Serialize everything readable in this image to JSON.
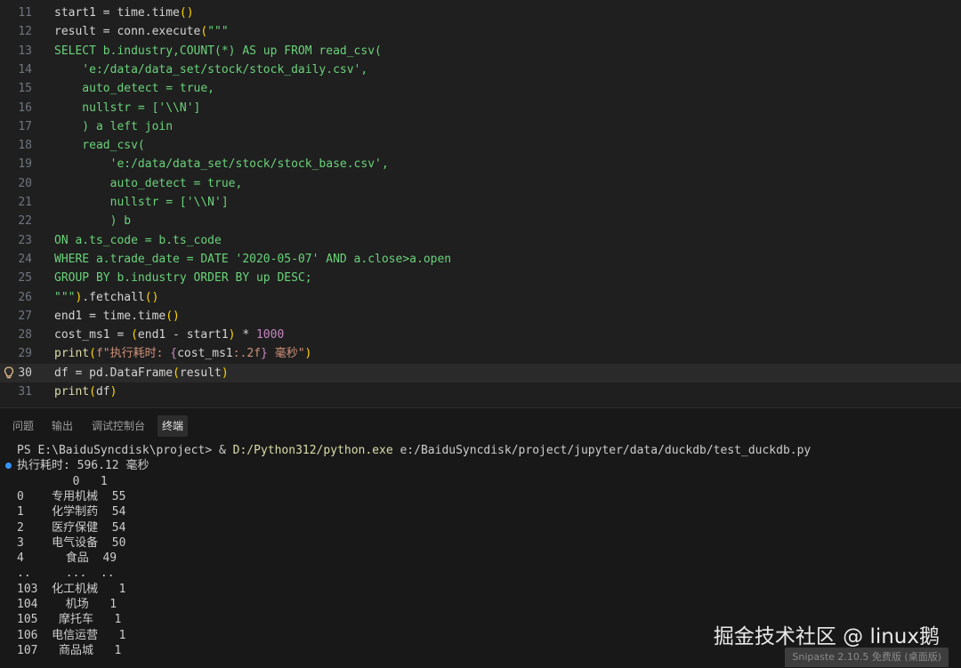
{
  "colors": {
    "keyword": "#4ec9b0",
    "plain": "#d4d4d4",
    "string": "#ce9178",
    "sql": "#6ad27a",
    "number": "#c586c0",
    "builtin": "#dcdcaa",
    "bracket": "#ffd700",
    "path": "#dcdcaa"
  },
  "editor": {
    "active_line": "30",
    "lines": [
      {
        "n": "11",
        "segs": [
          [
            "start1 = time.time",
            "plain"
          ],
          [
            "()",
            "bracket"
          ]
        ]
      },
      {
        "n": "12",
        "segs": [
          [
            "result = conn.execute",
            "plain"
          ],
          [
            "(",
            "bracket"
          ],
          [
            "\"\"\"",
            "sql"
          ]
        ]
      },
      {
        "n": "13",
        "segs": [
          [
            "SELECT b.industry,COUNT(*) AS up FROM read_csv(",
            "sql"
          ]
        ]
      },
      {
        "n": "14",
        "segs": [
          [
            "    'e:/data/data_set/stock/stock_daily.csv',",
            "sql"
          ]
        ]
      },
      {
        "n": "15",
        "segs": [
          [
            "    auto_detect = true,",
            "sql"
          ]
        ]
      },
      {
        "n": "16",
        "segs": [
          [
            "    nullstr = ['\\\\N']",
            "sql"
          ]
        ]
      },
      {
        "n": "17",
        "segs": [
          [
            "    ) a left join",
            "sql"
          ]
        ]
      },
      {
        "n": "18",
        "segs": [
          [
            "    read_csv(",
            "sql"
          ]
        ]
      },
      {
        "n": "19",
        "segs": [
          [
            "        'e:/data/data_set/stock/stock_base.csv',",
            "sql"
          ]
        ]
      },
      {
        "n": "20",
        "segs": [
          [
            "        auto_detect = true,",
            "sql"
          ]
        ]
      },
      {
        "n": "21",
        "segs": [
          [
            "        nullstr = ['\\\\N']",
            "sql"
          ]
        ]
      },
      {
        "n": "22",
        "segs": [
          [
            "        ) b",
            "sql"
          ]
        ]
      },
      {
        "n": "23",
        "segs": [
          [
            "ON a.ts_code = b.ts_code",
            "sql"
          ]
        ]
      },
      {
        "n": "24",
        "segs": [
          [
            "WHERE a.trade_date = DATE '2020-05-07' AND a.close>a.open",
            "sql"
          ]
        ]
      },
      {
        "n": "25",
        "segs": [
          [
            "GROUP BY b.industry ORDER BY up DESC;",
            "sql"
          ]
        ]
      },
      {
        "n": "26",
        "segs": [
          [
            "\"\"\"",
            "sql"
          ],
          [
            ")",
            "bracket"
          ],
          [
            ".fetchall",
            "plain"
          ],
          [
            "()",
            "bracket"
          ]
        ]
      },
      {
        "n": "27",
        "segs": [
          [
            "end1 = time.time",
            "plain"
          ],
          [
            "()",
            "bracket"
          ]
        ]
      },
      {
        "n": "28",
        "segs": [
          [
            "cost_ms1 = ",
            "plain"
          ],
          [
            "(",
            "bracket"
          ],
          [
            "end1 - start1",
            "plain"
          ],
          [
            ")",
            "bracket"
          ],
          [
            " * ",
            "plain"
          ],
          [
            "1000",
            "number"
          ]
        ]
      },
      {
        "n": "29",
        "segs": [
          [
            "print",
            "builtin"
          ],
          [
            "(",
            "bracket"
          ],
          [
            "f\"执行耗时: ",
            "string"
          ],
          [
            "{",
            "number"
          ],
          [
            "cost_ms1",
            "plain"
          ],
          [
            ":.2f",
            "string"
          ],
          [
            "}",
            "number"
          ],
          [
            " 毫秒\"",
            "string"
          ],
          [
            ")",
            "bracket"
          ]
        ]
      },
      {
        "n": "30",
        "segs": [
          [
            "df = pd.DataFrame",
            "plain"
          ],
          [
            "(",
            "bracket"
          ],
          [
            "result",
            "plain"
          ],
          [
            ")",
            "bracket"
          ]
        ]
      },
      {
        "n": "31",
        "segs": [
          [
            "print",
            "builtin"
          ],
          [
            "(",
            "bracket"
          ],
          [
            "df",
            "plain"
          ],
          [
            ")",
            "bracket"
          ]
        ]
      }
    ]
  },
  "panel": {
    "tabs": [
      "问题",
      "输出",
      "调试控制台",
      "终端"
    ],
    "active_tab": "终端"
  },
  "terminal": {
    "lines": [
      {
        "dot": false,
        "segs": [
          [
            "PS E:\\BaiduSyncdisk\\project> & ",
            "plain"
          ],
          [
            "D:/Python312/python.exe",
            "path"
          ],
          [
            " e:/BaiduSyncdisk/project/jupyter/data/duckdb/test_duckdb.py",
            "plain"
          ]
        ]
      },
      {
        "dot": true,
        "segs": [
          [
            "执行耗时: 596.12 毫秒",
            "plain"
          ]
        ]
      },
      {
        "dot": false,
        "segs": [
          [
            "        0   1",
            "plain"
          ]
        ]
      },
      {
        "dot": false,
        "segs": [
          [
            "0    专用机械  55",
            "plain"
          ]
        ]
      },
      {
        "dot": false,
        "segs": [
          [
            "1    化学制药  54",
            "plain"
          ]
        ]
      },
      {
        "dot": false,
        "segs": [
          [
            "2    医疗保健  54",
            "plain"
          ]
        ]
      },
      {
        "dot": false,
        "segs": [
          [
            "3    电气设备  50",
            "plain"
          ]
        ]
      },
      {
        "dot": false,
        "segs": [
          [
            "4      食品  49",
            "plain"
          ]
        ]
      },
      {
        "dot": false,
        "segs": [
          [
            "..     ...  ..",
            "plain"
          ]
        ]
      },
      {
        "dot": false,
        "segs": [
          [
            "103  化工机械   1",
            "plain"
          ]
        ]
      },
      {
        "dot": false,
        "segs": [
          [
            "104    机场   1",
            "plain"
          ]
        ]
      },
      {
        "dot": false,
        "segs": [
          [
            "105   摩托车   1",
            "plain"
          ]
        ]
      },
      {
        "dot": false,
        "segs": [
          [
            "106  电信运营   1",
            "plain"
          ]
        ]
      },
      {
        "dot": false,
        "segs": [
          [
            "107   商品城   1",
            "plain"
          ]
        ]
      }
    ]
  },
  "watermark": "掘金技术社区 @ linux鹅",
  "snipaste_badge": "Snipaste 2.10.5 免费版 (桌面版)"
}
